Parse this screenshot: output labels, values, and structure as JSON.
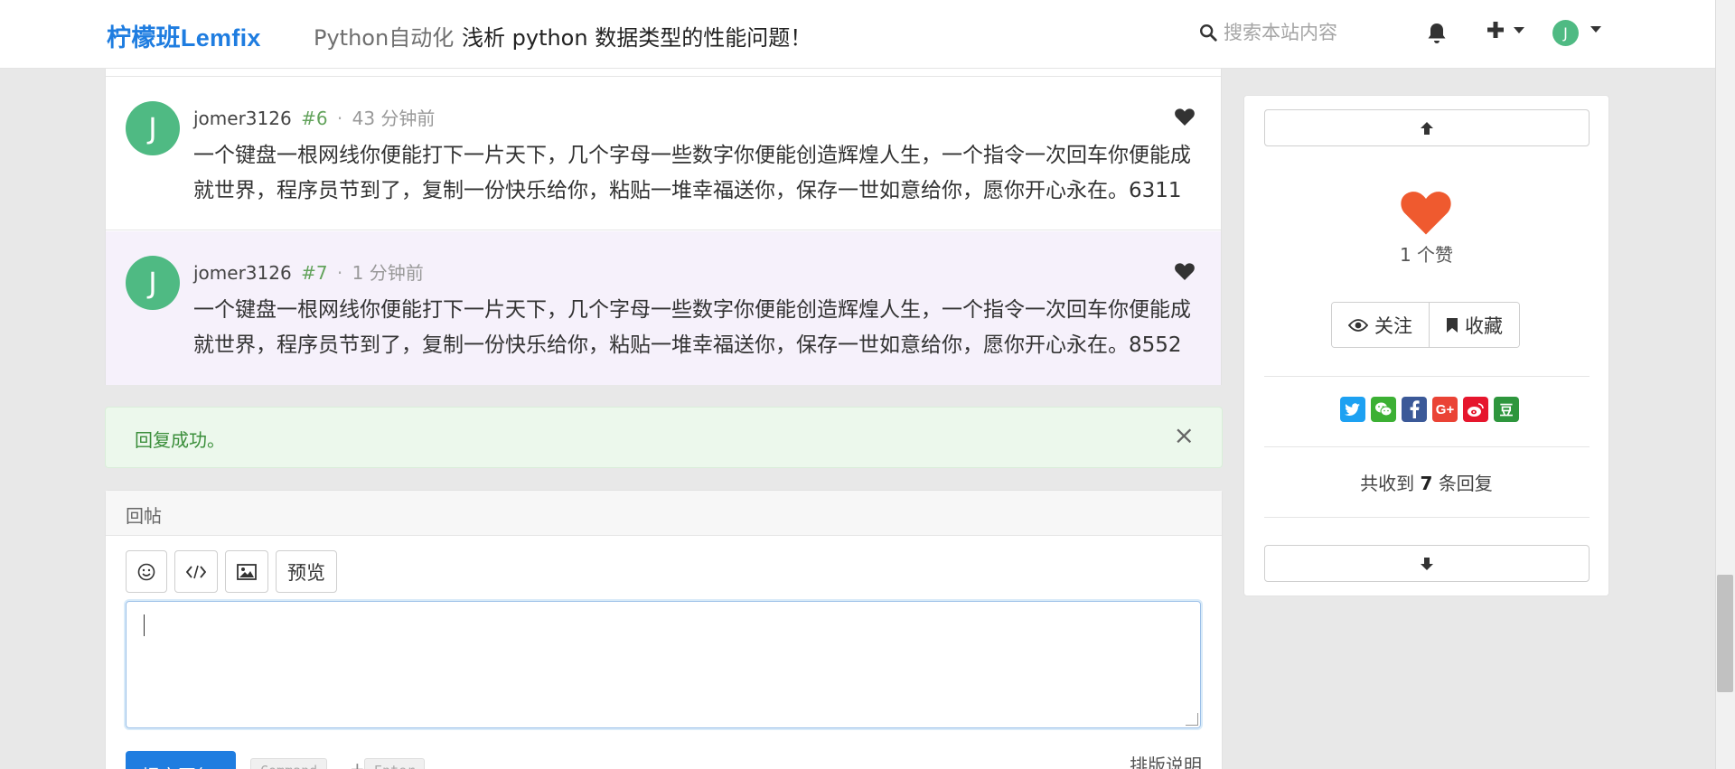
{
  "navbar": {
    "brand": "柠檬班Lemfix",
    "category": "Python自动化",
    "title": "浅析 python 数据类型的性能问题！",
    "search_placeholder": "搜索本站内容",
    "avatar_initial": "J"
  },
  "comments": [
    {
      "user": "jomer3126",
      "floor": "#6",
      "separator": "·",
      "time": "43 分钟前",
      "avatar_initial": "J",
      "text": "一个键盘一根网线你便能打下一片天下，几个字母一些数字你便能创造辉煌人生，一个指令一次回车你便能成就世界，程序员节到了，复制一份快乐给你，粘贴一堆幸福送你，保存一世如意给你，愿你开心永在。6311"
    },
    {
      "user": "jomer3126",
      "floor": "#7",
      "separator": "·",
      "time": "1 分钟前",
      "avatar_initial": "J",
      "text": "一个键盘一根网线你便能打下一片天下，几个字母一些数字你便能创造辉煌人生，一个指令一次回车你便能成就世界，程序员节到了，复制一份快乐给你，粘贴一堆幸福送你，保存一世如意给你，愿你开心永在。8552"
    }
  ],
  "alert": {
    "message": "回复成功。",
    "close": "×"
  },
  "editor": {
    "heading": "回帖",
    "preview_label": "预览",
    "submit_label": "提交回复",
    "kbd_command": "Command",
    "kbd_plus": "+",
    "kbd_enter": "Enter",
    "format_help": "排版说明"
  },
  "sidebar": {
    "likes_text": "1 个赞",
    "follow_label": "关注",
    "favorite_label": "收藏",
    "reply_total_prefix": "共收到",
    "reply_total_count": "7",
    "reply_total_suffix": "条回复",
    "share_douban": "豆",
    "share_gplus": "G+"
  },
  "colors": {
    "brand": "#1f7de0",
    "avatar": "#4fba83",
    "heart": "#ef5a2f",
    "alert_text": "#3a8e3a"
  }
}
